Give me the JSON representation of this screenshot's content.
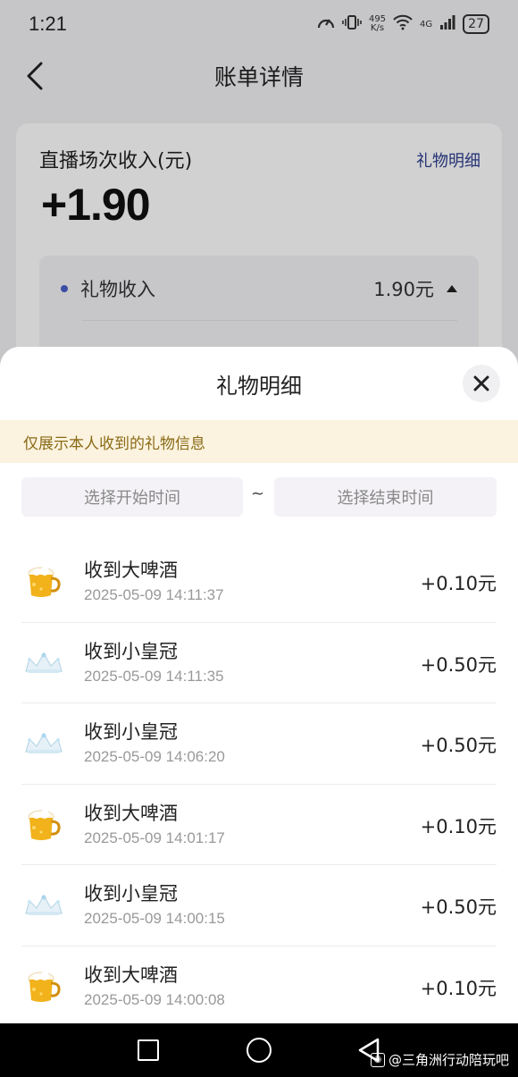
{
  "status_bar": {
    "time": "1:21",
    "net_speed_value": "495",
    "net_speed_unit": "K/s",
    "network": "4G",
    "battery": "27"
  },
  "navbar": {
    "title": "账单详情"
  },
  "income_card": {
    "label": "直播场次收入(元)",
    "detail_link": "礼物明细",
    "amount": "+1.90",
    "sub_label": "礼物收入",
    "sub_value": "1.90元"
  },
  "sheet": {
    "title": "礼物明细",
    "notice": "仅展示本人收到的礼物信息",
    "start_placeholder": "选择开始时间",
    "separator": "~",
    "end_placeholder": "选择结束时间",
    "items": [
      {
        "name": "收到大啤酒",
        "time": "2025-05-09 14:11:37",
        "amount": "+0.10元",
        "icon": "beer-icon"
      },
      {
        "name": "收到小皇冠",
        "time": "2025-05-09 14:11:35",
        "amount": "+0.50元",
        "icon": "crown-icon"
      },
      {
        "name": "收到小皇冠",
        "time": "2025-05-09 14:06:20",
        "amount": "+0.50元",
        "icon": "crown-icon"
      },
      {
        "name": "收到大啤酒",
        "time": "2025-05-09 14:01:17",
        "amount": "+0.10元",
        "icon": "beer-icon"
      },
      {
        "name": "收到小皇冠",
        "time": "2025-05-09 14:00:15",
        "amount": "+0.50元",
        "icon": "crown-icon"
      },
      {
        "name": "收到大啤酒",
        "time": "2025-05-09 14:00:08",
        "amount": "+0.10元",
        "icon": "beer-icon"
      }
    ]
  },
  "watermark": {
    "text": "@三角洲行动陪玩吧"
  },
  "colors": {
    "link": "#2e3f8f",
    "notice_bg": "#fbf3df",
    "notice_text": "#8a6a16",
    "dot": "#4a5fc8"
  }
}
